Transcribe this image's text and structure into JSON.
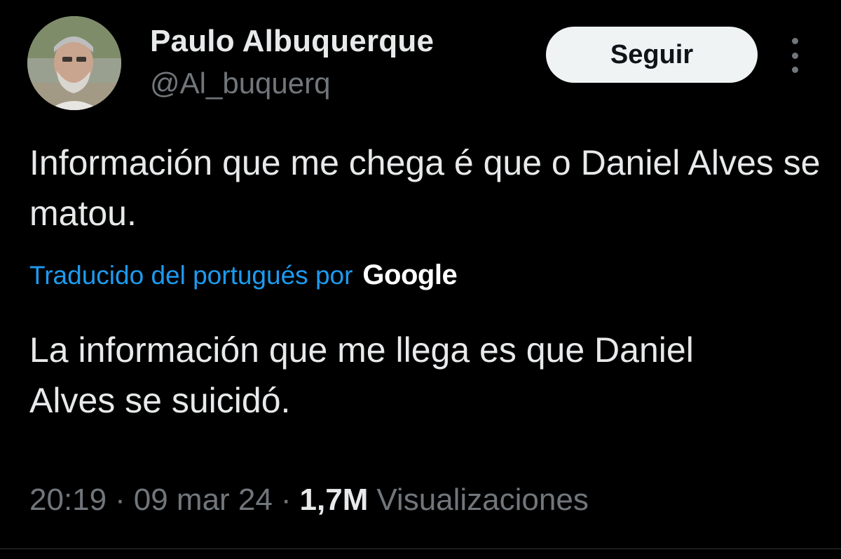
{
  "author": {
    "name": "Paulo Albuquerque",
    "handle": "@Al_buquerq"
  },
  "follow_button": {
    "label": "Seguir"
  },
  "more_button": {
    "icon": "vertical-ellipsis-icon"
  },
  "tweet": {
    "original_text": "Información que me chega é que o Daniel Alves se matou.",
    "translation_label": "Traducido del portugués por",
    "translation_provider": "Google",
    "translated_text": "La información que me llega es que Daniel Alves se suicidó."
  },
  "meta": {
    "time": "20:19",
    "separator": "·",
    "date": "09 mar 24",
    "views_count": "1,7M",
    "views_label": "Visualizaciones"
  },
  "colors": {
    "background": "#000000",
    "primary_text": "#e7e9ea",
    "secondary_text": "#71767b",
    "link": "#1d9bf0",
    "button_bg": "#eff3f4"
  }
}
